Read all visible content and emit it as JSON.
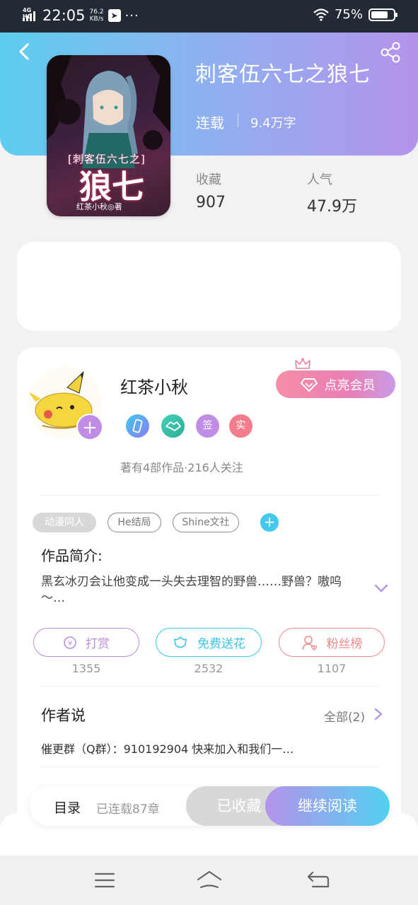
{
  "status_bar": {
    "network": "4G HD",
    "time": "22:05",
    "speed_value": "76.2",
    "speed_unit": "KB/s",
    "dots": "···",
    "battery": "75%"
  },
  "book": {
    "title": "刺客伍六七之狼七",
    "status": "连载",
    "word_count": "9.4万字",
    "cover": {
      "tagline": "[刺客伍六七之]",
      "big_title": "狼七",
      "author_line": "红茶小秋◎著"
    },
    "stats": [
      {
        "label": "收藏",
        "value": "907"
      },
      {
        "label": "人气",
        "value": "47.9万"
      }
    ]
  },
  "author": {
    "name": "红茶小秋",
    "vip_label": "点亮会员",
    "badges": [
      {
        "icon": "phone-badge-icon",
        "text": "",
        "color": "#3aa3f0"
      },
      {
        "icon": "handshake-badge-icon",
        "text": "",
        "color": "#3cc6a8"
      },
      {
        "icon": "signed-badge-icon",
        "text": "签",
        "color": "#c08de6"
      },
      {
        "icon": "verified-badge-icon",
        "text": "实",
        "color": "#f37d8c"
      }
    ],
    "meta": "著有4部作品·216人关注"
  },
  "tags": [
    {
      "label": "动漫同人",
      "style": "filled"
    },
    {
      "label": "He结局",
      "style": "outline"
    },
    {
      "label": "Shine文社",
      "style": "outline"
    }
  ],
  "intro": {
    "heading": "作品简介:",
    "text": "黑玄冰刃会让他变成一头失去理智的野兽……野兽？嗷呜～…"
  },
  "actions": [
    {
      "label": "打赏",
      "count": "1355",
      "icon": "coin-icon",
      "color": "#b98ee0"
    },
    {
      "label": "免费送花",
      "count": "2532",
      "icon": "flower-icon",
      "color": "#3bc7e6"
    },
    {
      "label": "粉丝榜",
      "count": "1107",
      "icon": "fans-icon",
      "color": "#ef8a8a"
    }
  ],
  "author_says": {
    "heading": "作者说",
    "all_label": "全部(2)",
    "text": "催更群（Q群）：910192904 快来加入和我们一…"
  },
  "bottom_bar": {
    "toc_label": "目录",
    "serial_label": "已连载87章",
    "collected_label": "已收藏",
    "read_label": "继续阅读"
  },
  "colors": {
    "accent_blue": "#52d0f0",
    "accent_purple": "#b493ec"
  }
}
